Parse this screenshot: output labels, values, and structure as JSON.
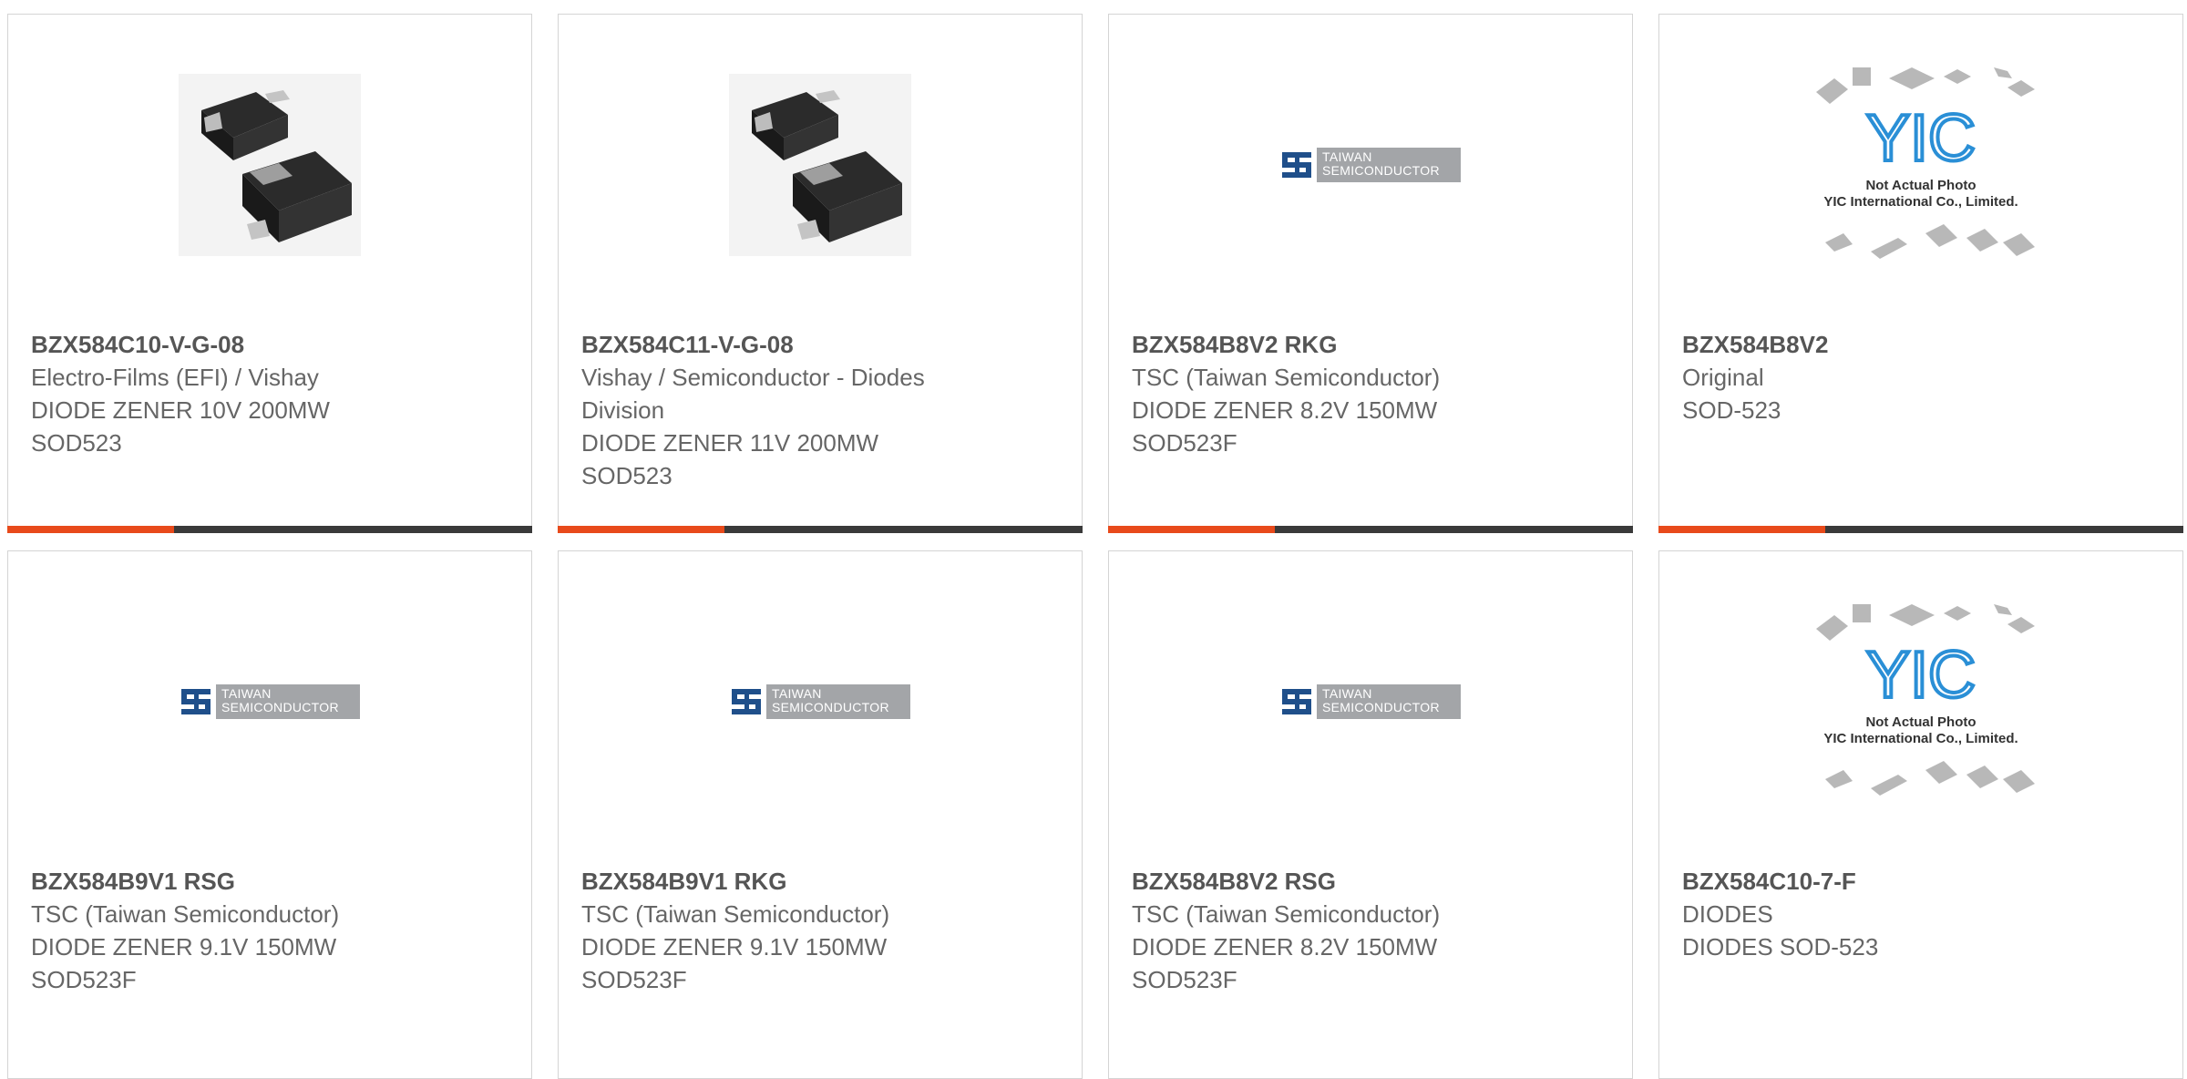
{
  "products": [
    {
      "part": "BZX584C10-V-G-08",
      "lines": [
        "Electro-Films (EFI) / Vishay",
        "DIODE ZENER 10V 200MW",
        "SOD523"
      ],
      "image": "diode-package-photo"
    },
    {
      "part": "BZX584C11-V-G-08",
      "lines": [
        "Vishay / Semiconductor - Diodes",
        "Division",
        "DIODE ZENER 11V 200MW",
        "SOD523"
      ],
      "image": "diode-package-photo"
    },
    {
      "part": "BZX584B8V2 RKG",
      "lines": [
        "TSC (Taiwan Semiconductor)",
        "DIODE ZENER 8.2V 150MW",
        "SOD523F"
      ],
      "image": "taiwan-semiconductor-logo"
    },
    {
      "part": "BZX584B8V2",
      "lines": [
        "Original",
        "SOD-523"
      ],
      "image": "yic-placeholder"
    },
    {
      "part": "BZX584B9V1 RSG",
      "lines": [
        "TSC (Taiwan Semiconductor)",
        "DIODE ZENER 9.1V 150MW",
        "SOD523F"
      ],
      "image": "taiwan-semiconductor-logo"
    },
    {
      "part": "BZX584B9V1 RKG",
      "lines": [
        "TSC (Taiwan Semiconductor)",
        "DIODE ZENER 9.1V 150MW",
        "SOD523F"
      ],
      "image": "taiwan-semiconductor-logo"
    },
    {
      "part": "BZX584B8V2 RSG",
      "lines": [
        "TSC (Taiwan Semiconductor)",
        "DIODE ZENER 8.2V 150MW",
        "SOD523F"
      ],
      "image": "taiwan-semiconductor-logo"
    },
    {
      "part": "BZX584C10-7-F",
      "lines": [
        "DIODES",
        "DIODES SOD-523"
      ],
      "image": "yic-placeholder"
    }
  ],
  "logos": {
    "tsc_line1": "TAIWAN",
    "tsc_line2": "SEMICONDUCTOR",
    "yic_text": "YIC",
    "yic_caption1": "Not Actual Photo",
    "yic_caption2": "YIC International Co., Limited."
  },
  "colors": {
    "accent": "#e84a1b",
    "bar": "#3a3a3a",
    "tsc_blue": "#1f4f8a",
    "yic_blue": "#2a8fd6"
  }
}
